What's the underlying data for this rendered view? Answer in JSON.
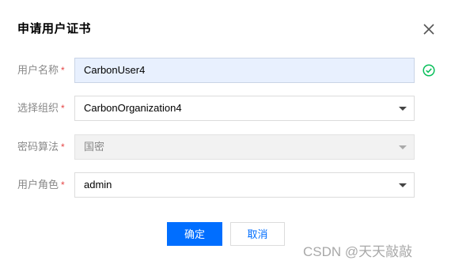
{
  "dialog": {
    "title": "申请用户证书"
  },
  "form": {
    "username": {
      "label": "用户名称",
      "required_mark": "*",
      "value": "CarbonUser4",
      "valid": true
    },
    "organization": {
      "label": "选择组织",
      "required_mark": "*",
      "value": "CarbonOrganization4"
    },
    "algorithm": {
      "label": "密码算法",
      "required_mark": "*",
      "value": "国密",
      "disabled": true
    },
    "role": {
      "label": "用户角色",
      "required_mark": "*",
      "value": "admin"
    }
  },
  "buttons": {
    "confirm_label": "确定",
    "cancel_label": "取消"
  },
  "watermark": "CSDN @天天敲敲",
  "colors": {
    "primary": "#006eff",
    "required": "#e54545",
    "success": "#0abf5b",
    "focused_bg": "#e8f0fe"
  }
}
